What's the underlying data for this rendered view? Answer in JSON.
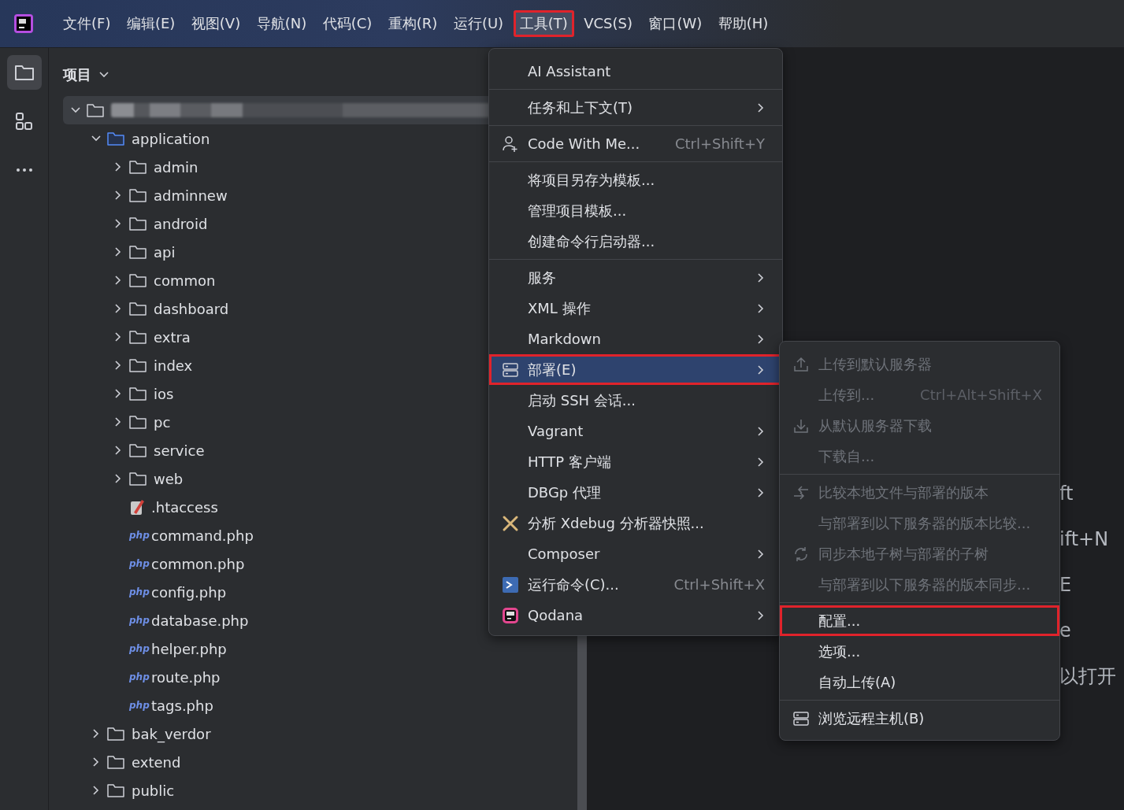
{
  "menubar": {
    "items": [
      {
        "label": "文件(F)",
        "selected": false,
        "highlighted": false
      },
      {
        "label": "编辑(E)",
        "selected": false,
        "highlighted": false
      },
      {
        "label": "视图(V)",
        "selected": false,
        "highlighted": false
      },
      {
        "label": "导航(N)",
        "selected": false,
        "highlighted": false
      },
      {
        "label": "代码(C)",
        "selected": false,
        "highlighted": false
      },
      {
        "label": "重构(R)",
        "selected": false,
        "highlighted": false
      },
      {
        "label": "运行(U)",
        "selected": false,
        "highlighted": false
      },
      {
        "label": "工具(T)",
        "selected": true,
        "highlighted": true
      },
      {
        "label": "VCS(S)",
        "selected": false,
        "highlighted": false
      },
      {
        "label": "窗口(W)",
        "selected": false,
        "highlighted": false
      },
      {
        "label": "帮助(H)",
        "selected": false,
        "highlighted": false
      }
    ]
  },
  "toolbar": {
    "items": [
      {
        "kind": "project",
        "selected": true
      },
      {
        "kind": "structure",
        "selected": false
      },
      {
        "kind": "more",
        "selected": false
      }
    ]
  },
  "project_panel": {
    "title": "项目",
    "tree": [
      {
        "kind": "folder",
        "label_hidden": true,
        "expanded": true,
        "selected": true,
        "children": [
          {
            "kind": "folder",
            "label": "application",
            "expanded": true,
            "selected": false,
            "children": [
              {
                "kind": "folder",
                "label": "admin",
                "expanded": false,
                "selected": false
              },
              {
                "kind": "folder",
                "label": "adminnew",
                "expanded": false,
                "selected": false
              },
              {
                "kind": "folder",
                "label": "android",
                "expanded": false,
                "selected": false
              },
              {
                "kind": "folder",
                "label": "api",
                "expanded": false,
                "selected": false
              },
              {
                "kind": "folder",
                "label": "common",
                "expanded": false,
                "selected": false
              },
              {
                "kind": "folder",
                "label": "dashboard",
                "expanded": false,
                "selected": false
              },
              {
                "kind": "folder",
                "label": "extra",
                "expanded": false,
                "selected": false
              },
              {
                "kind": "folder",
                "label": "index",
                "expanded": false,
                "selected": false
              },
              {
                "kind": "folder",
                "label": "ios",
                "expanded": false,
                "selected": false
              },
              {
                "kind": "folder",
                "label": "pc",
                "expanded": false,
                "selected": false
              },
              {
                "kind": "folder",
                "label": "service",
                "expanded": false,
                "selected": false
              },
              {
                "kind": "folder",
                "label": "web",
                "expanded": false,
                "selected": false
              },
              {
                "kind": "config",
                "label": ".htaccess",
                "selected": false
              },
              {
                "kind": "php",
                "badge": "php",
                "label": "command.php",
                "selected": false
              },
              {
                "kind": "php",
                "badge": "php",
                "label": "common.php",
                "selected": false
              },
              {
                "kind": "php",
                "badge": "php",
                "label": "config.php",
                "selected": false
              },
              {
                "kind": "php",
                "badge": "php",
                "label": "database.php",
                "selected": false
              },
              {
                "kind": "php",
                "badge": "php",
                "label": "helper.php",
                "selected": false
              },
              {
                "kind": "php",
                "badge": "php",
                "label": "route.php",
                "selected": false
              },
              {
                "kind": "php",
                "badge": "php",
                "label": "tags.php",
                "selected": false
              }
            ]
          },
          {
            "kind": "folder",
            "label": "bak_verdor",
            "expanded": false,
            "selected": false
          },
          {
            "kind": "folder",
            "label": "extend",
            "expanded": false,
            "selected": false
          },
          {
            "kind": "folder",
            "label": "public",
            "expanded": false,
            "selected": false
          }
        ]
      }
    ]
  },
  "editor": {
    "hints": [
      "ft",
      "ift+N",
      "E",
      "e",
      "以打开"
    ]
  },
  "tools_menu": {
    "items": [
      {
        "kind": "plain",
        "label": "AI Assistant",
        "submenu": false,
        "selected": false,
        "highlighted": false
      },
      {
        "kind": "separator"
      },
      {
        "kind": "plain",
        "label": "任务和上下文(T)",
        "submenu": true,
        "selected": false,
        "highlighted": false
      },
      {
        "kind": "separator"
      },
      {
        "kind": "collab",
        "label": "Code With Me...",
        "shortcut": "Ctrl+Shift+Y",
        "submenu": false,
        "selected": false,
        "highlighted": false
      },
      {
        "kind": "separator"
      },
      {
        "kind": "plain",
        "label": "将项目另存为模板...",
        "submenu": false,
        "selected": false,
        "highlighted": false
      },
      {
        "kind": "plain",
        "label": "管理项目模板...",
        "submenu": false,
        "selected": false,
        "highlighted": false
      },
      {
        "kind": "plain",
        "label": "创建命令行启动器...",
        "submenu": false,
        "selected": false,
        "highlighted": false
      },
      {
        "kind": "separator"
      },
      {
        "kind": "plain",
        "label": "服务",
        "submenu": true,
        "selected": false,
        "highlighted": false
      },
      {
        "kind": "plain",
        "label": "XML 操作",
        "submenu": true,
        "selected": false,
        "highlighted": false
      },
      {
        "kind": "plain",
        "label": "Markdown",
        "submenu": true,
        "selected": false,
        "highlighted": false
      },
      {
        "kind": "server",
        "label": "部署(E)",
        "submenu": true,
        "selected": true,
        "highlighted": true
      },
      {
        "kind": "plain",
        "label": "启动 SSH 会话...",
        "submenu": false,
        "selected": false,
        "highlighted": false
      },
      {
        "kind": "plain",
        "label": "Vagrant",
        "submenu": true,
        "selected": false,
        "highlighted": false
      },
      {
        "kind": "plain",
        "label": "HTTP 客户端",
        "submenu": true,
        "selected": false,
        "highlighted": false
      },
      {
        "kind": "plain",
        "label": "DBGp 代理",
        "submenu": true,
        "selected": false,
        "highlighted": false
      },
      {
        "kind": "xdebug",
        "label": "分析 Xdebug 分析器快照...",
        "submenu": false,
        "selected": false,
        "highlighted": false
      },
      {
        "kind": "plain",
        "label": "Composer",
        "submenu": true,
        "selected": false,
        "highlighted": false
      },
      {
        "kind": "terminal",
        "label": "运行命令(C)...",
        "shortcut": "Ctrl+Shift+X",
        "submenu": false,
        "selected": false,
        "highlighted": false
      },
      {
        "kind": "qodana",
        "label": "Qodana",
        "submenu": true,
        "selected": false,
        "highlighted": false
      }
    ]
  },
  "deployment_menu": {
    "items": [
      {
        "kind": "upload",
        "label": "上传到默认服务器",
        "disabled": true,
        "highlighted": false
      },
      {
        "kind": "plain",
        "label": "上传到...",
        "shortcut": "Ctrl+Alt+Shift+X",
        "disabled": true,
        "highlighted": false
      },
      {
        "kind": "download",
        "label": "从默认服务器下载",
        "disabled": true,
        "highlighted": false
      },
      {
        "kind": "plain",
        "label": "下载自...",
        "disabled": true,
        "highlighted": false
      },
      {
        "kind": "separator"
      },
      {
        "kind": "compare",
        "label": "比较本地文件与部署的版本",
        "disabled": true,
        "highlighted": false
      },
      {
        "kind": "plain",
        "label": "与部署到以下服务器的版本比较...",
        "disabled": true,
        "highlighted": false
      },
      {
        "kind": "sync",
        "label": "同步本地子树与部署的子树",
        "disabled": true,
        "highlighted": false
      },
      {
        "kind": "plain",
        "label": "与部署到以下服务器的版本同步...",
        "disabled": true,
        "highlighted": false
      },
      {
        "kind": "separator"
      },
      {
        "kind": "plain",
        "label": "配置...",
        "disabled": false,
        "highlighted": true
      },
      {
        "kind": "plain",
        "label": "选项...",
        "disabled": false,
        "highlighted": false
      },
      {
        "kind": "plain",
        "label": "自动上传(A)",
        "disabled": false,
        "highlighted": false
      },
      {
        "kind": "separator"
      },
      {
        "kind": "server",
        "label": "浏览远程主机(B)",
        "disabled": false,
        "highlighted": false
      }
    ]
  }
}
